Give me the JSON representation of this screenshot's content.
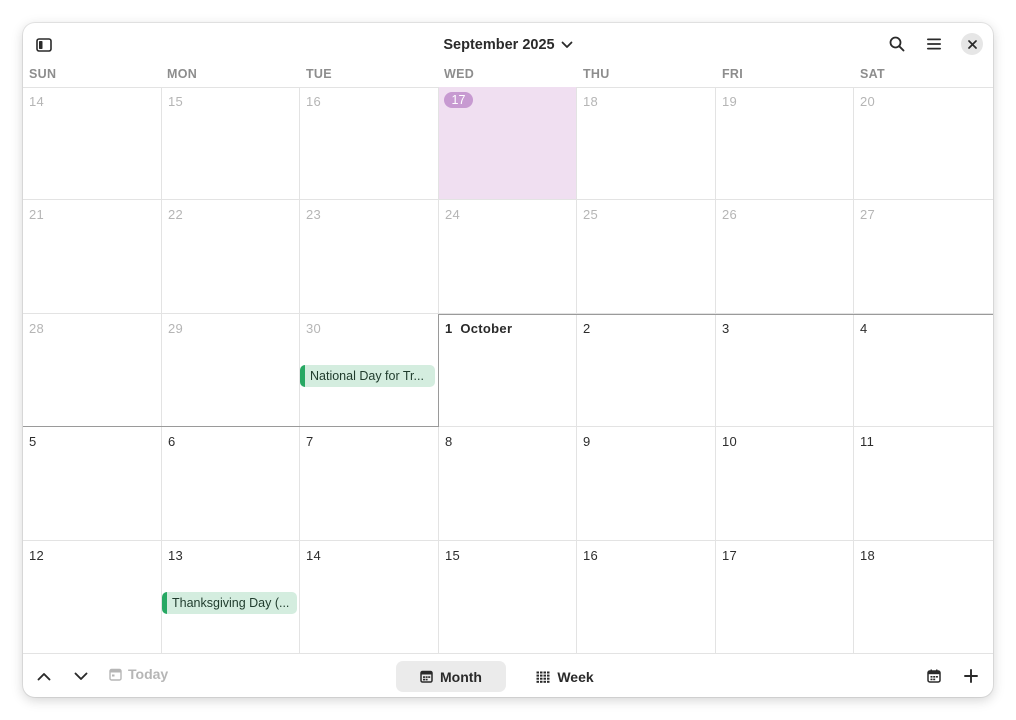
{
  "header": {
    "title": "September 2025",
    "icons": [
      "sidebar-toggle-icon",
      "chevron-down-icon",
      "search-icon",
      "hamburger-menu-icon",
      "close-icon"
    ]
  },
  "weekdays": [
    "SUN",
    "MON",
    "TUE",
    "WED",
    "THU",
    "FRI",
    "SAT"
  ],
  "weeks": [
    [
      "14",
      "15",
      "16",
      "17",
      "18",
      "19",
      "20"
    ],
    [
      "21",
      "22",
      "23",
      "24",
      "25",
      "26",
      "27"
    ],
    [
      "28",
      "29",
      "30",
      "1",
      "2",
      "3",
      "4"
    ],
    [
      "5",
      "6",
      "7",
      "8",
      "9",
      "10",
      "11"
    ],
    [
      "12",
      "13",
      "14",
      "15",
      "16",
      "17",
      "18"
    ]
  ],
  "today_label": "17",
  "month_start": {
    "day": "1",
    "month": "October"
  },
  "events": {
    "national_day": "National Day for Tr...",
    "thanksgiving": "Thanksgiving Day (..."
  },
  "footer": {
    "today_label": "Today",
    "month_label": "Month",
    "week_label": "Week"
  },
  "colors": {
    "today_bg": "#f0dff1",
    "today_badge": "#c79ad1",
    "event_bg": "#d4eddf",
    "event_accent": "#27a863"
  }
}
